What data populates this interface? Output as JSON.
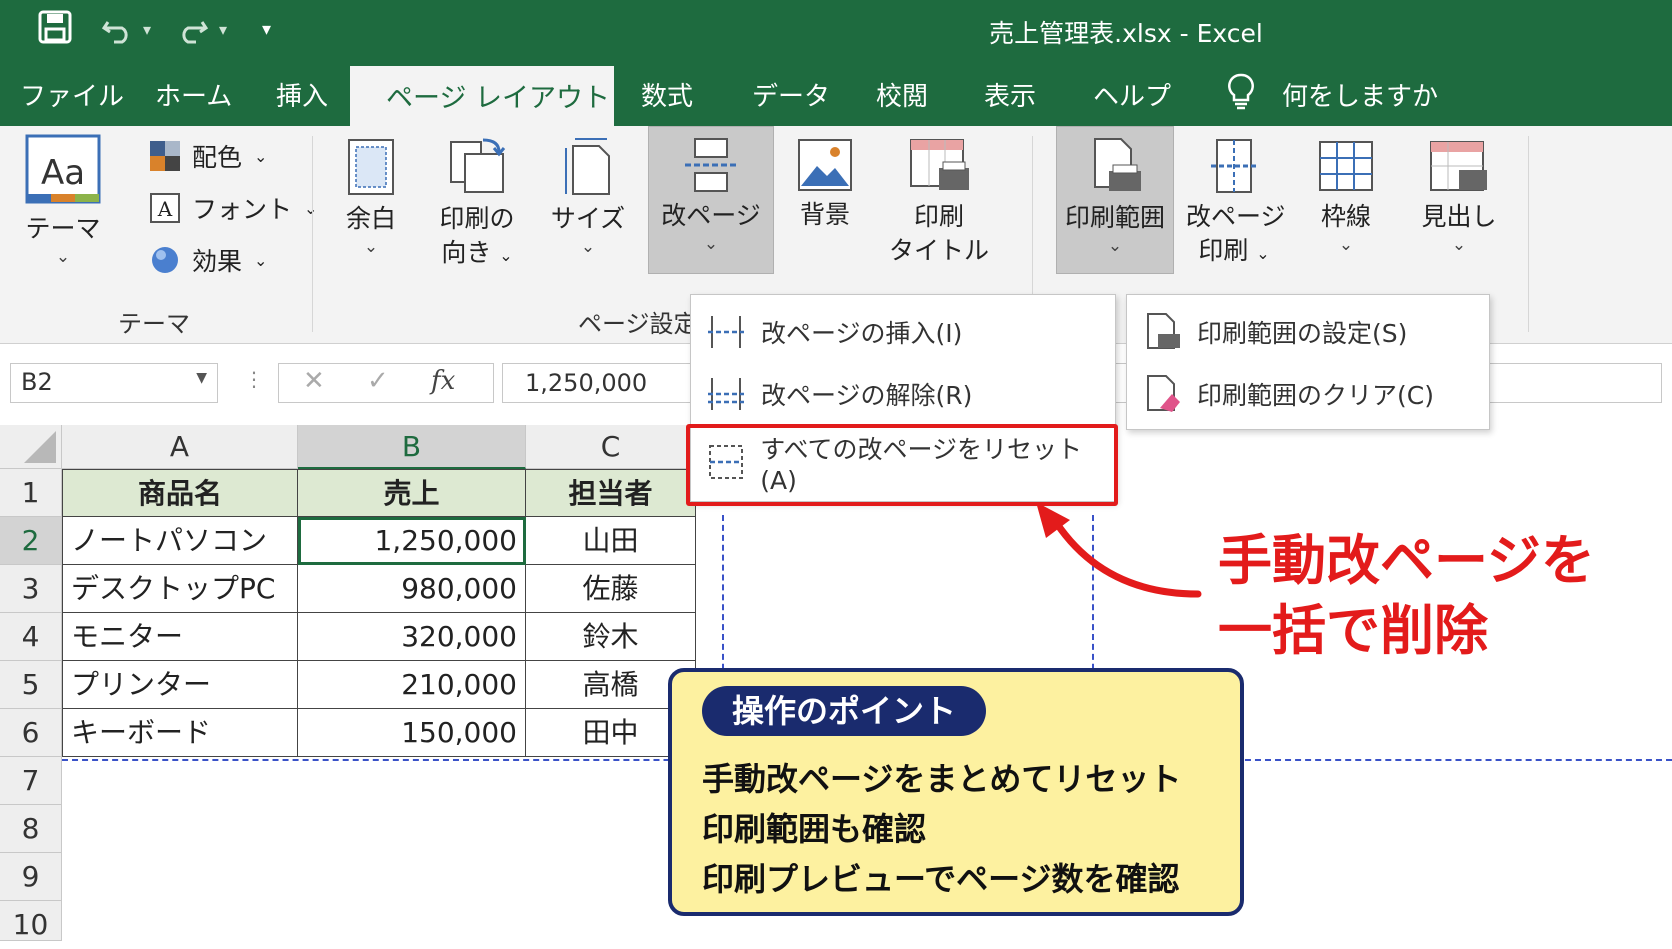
{
  "window": {
    "title": "売上管理表.xlsx  -  Excel"
  },
  "qat": {
    "more": "▾"
  },
  "tabs": [
    {
      "label": "ファイル"
    },
    {
      "label": "ホーム"
    },
    {
      "label": "挿入"
    },
    {
      "label": "ページ レイアウト",
      "active": true
    },
    {
      "label": "数式"
    },
    {
      "label": "データ"
    },
    {
      "label": "校閲"
    },
    {
      "label": "表示"
    },
    {
      "label": "ヘルプ"
    },
    {
      "label": "何をしますか"
    }
  ],
  "ribbon": {
    "theme": {
      "button": "テーマ",
      "colors": "配色",
      "fonts": "フォント",
      "effects": "効果",
      "group": "テーマ"
    },
    "page_setup": {
      "margins": "余白",
      "orientation_1": "印刷の",
      "orientation_2": "向き",
      "size": "サイズ",
      "breaks": "改ページ",
      "background": "背景",
      "print_titles_1": "印刷",
      "print_titles_2": "タイトル",
      "print_area": "印刷範囲",
      "page_breaks_print_1": "改ページ",
      "page_breaks_print_2": "印刷",
      "gridlines": "枠線",
      "headings": "見出し",
      "group": "ページ設定"
    }
  },
  "formula_bar": {
    "name_box": "B2",
    "fx": "fx",
    "value": "1,250,000"
  },
  "breaks_menu": [
    {
      "label": "改ページの挿入(I)"
    },
    {
      "label": "改ページの解除(R)"
    },
    {
      "label": "すべての改ページをリセット(A)"
    }
  ],
  "print_area_menu": [
    {
      "label": "印刷範囲の設定(S)"
    },
    {
      "label": "印刷範囲のクリア(C)"
    }
  ],
  "sheet": {
    "columns": [
      "A",
      "B",
      "C"
    ],
    "rows": [
      "1",
      "2",
      "3",
      "4",
      "5",
      "6",
      "7",
      "8",
      "9",
      "10"
    ],
    "header": [
      "商品名",
      "売上",
      "担当者"
    ],
    "data": [
      [
        "ノートパソコン",
        "1,250,000",
        "山田"
      ],
      [
        "デスクトップPC",
        "980,000",
        "佐藤"
      ],
      [
        "モニター",
        "320,000",
        "鈴木"
      ],
      [
        "プリンター",
        "210,000",
        "高橋"
      ],
      [
        "キーボード",
        "150,000",
        "田中"
      ]
    ]
  },
  "callout": {
    "line1": "手動改ページを",
    "line2": "一括で削除"
  },
  "note": {
    "title": "操作のポイント",
    "lines": [
      "手動改ページをまとめてリセット",
      "印刷範囲も確認",
      "印刷プレビューでページ数を確認"
    ]
  },
  "colors": {
    "excel_green": "#1e6b3f",
    "highlight_red": "#e21b1b",
    "note_bg": "#fdf1a0",
    "note_border": "#1a2b6e"
  }
}
